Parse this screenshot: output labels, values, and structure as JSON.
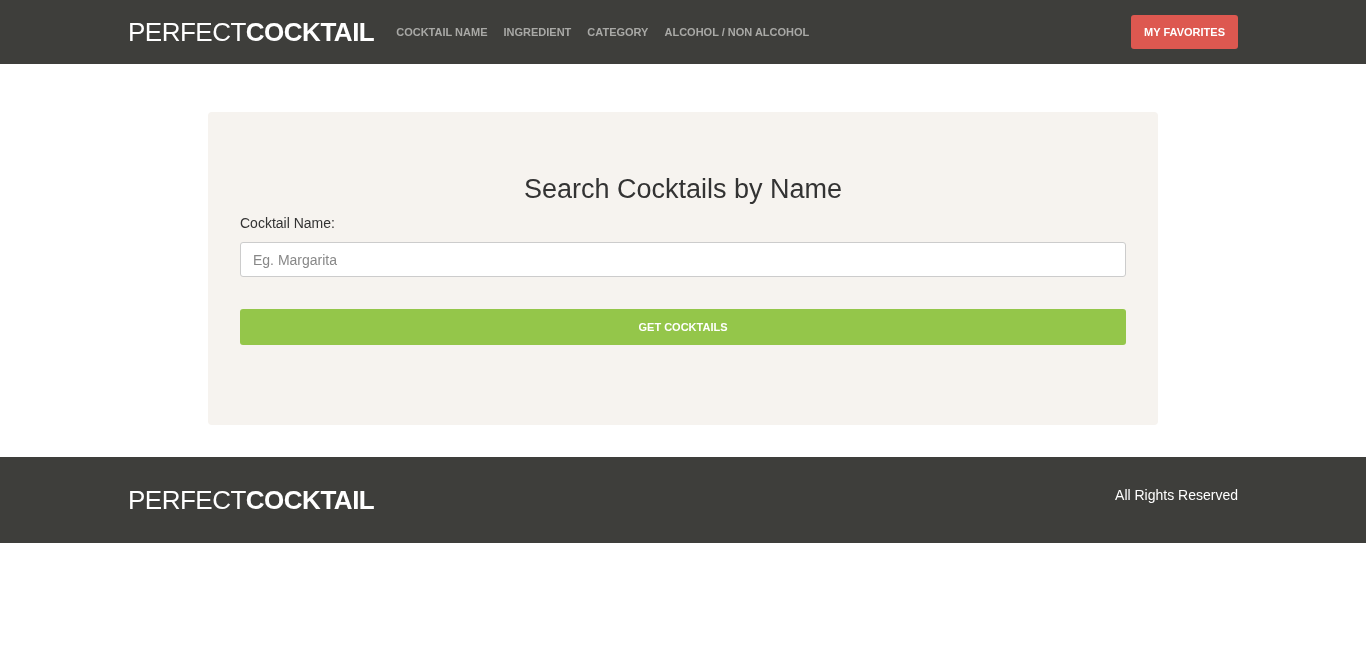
{
  "header": {
    "logo": "PERFECT**COCKTAIL**",
    "nav": [
      {
        "label": "COCKTAIL NAME"
      },
      {
        "label": "INGREDIENT"
      },
      {
        "label": "CATEGORY"
      },
      {
        "label": "ALCOHOL / NON ALCOHOL"
      }
    ],
    "favorites_button": "MY FAVORITES"
  },
  "search": {
    "title": "Search Cocktails by Name",
    "label": "Cocktail Name:",
    "placeholder": "Eg. Margarita",
    "button": "GET COCKTAILS"
  },
  "footer": {
    "logo": "PERFECT**COCKTAIL**",
    "text": "All Rights Reserved"
  }
}
